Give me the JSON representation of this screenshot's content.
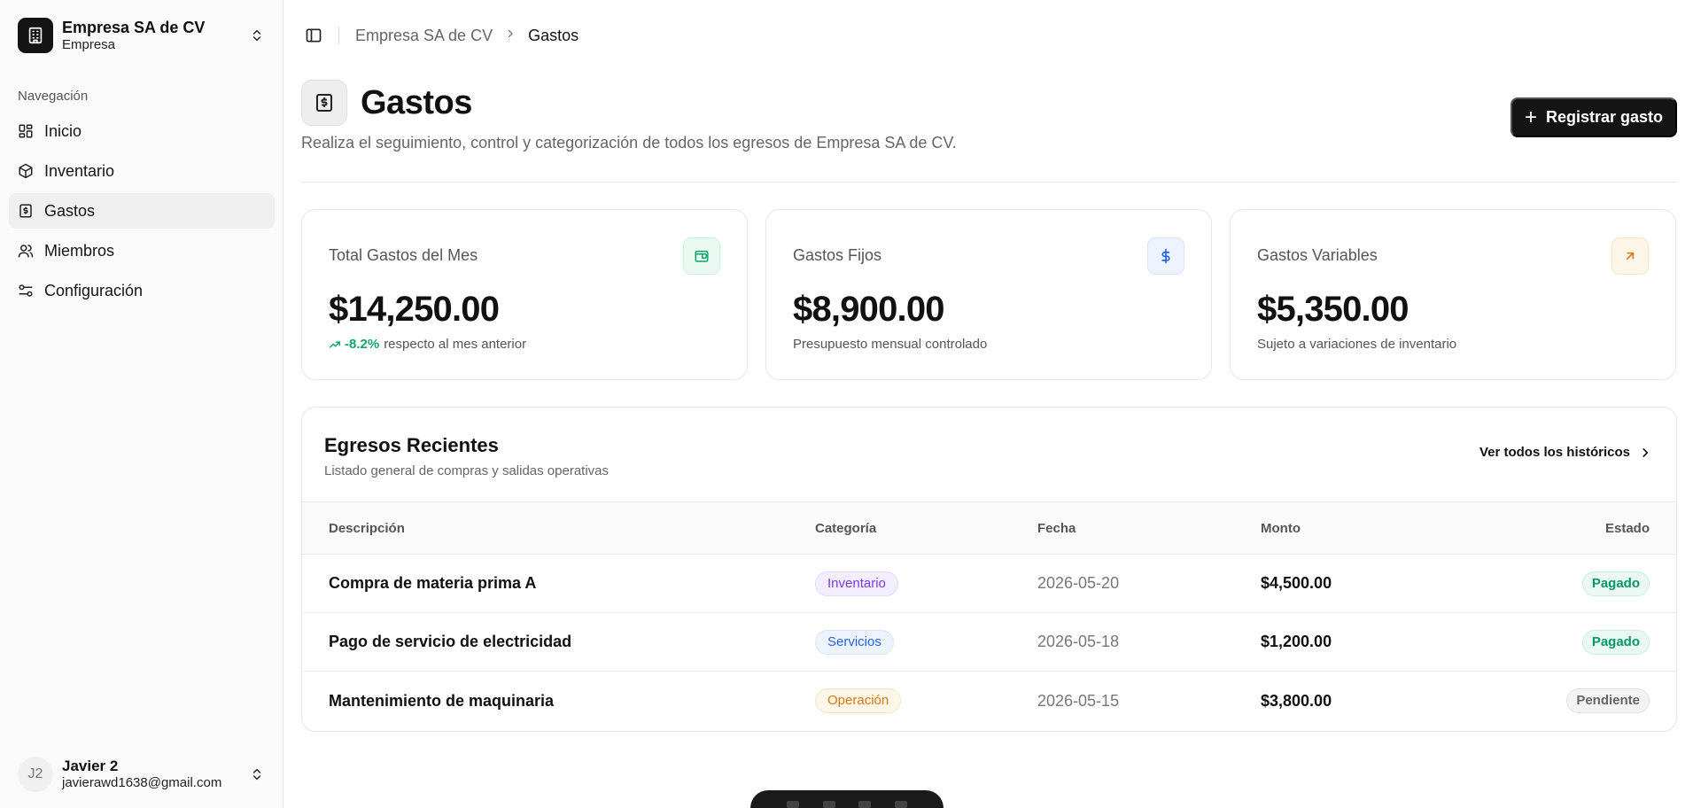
{
  "org": {
    "name": "Empresa SA de CV",
    "type": "Empresa"
  },
  "nav": {
    "heading": "Navegación",
    "items": [
      {
        "label": "Inicio",
        "icon": "dashboard-icon"
      },
      {
        "label": "Inventario",
        "icon": "package-icon"
      },
      {
        "label": "Gastos",
        "icon": "receipt-icon",
        "active": true
      },
      {
        "label": "Miembros",
        "icon": "users-icon"
      },
      {
        "label": "Configuración",
        "icon": "settings-icon"
      }
    ]
  },
  "user": {
    "initials": "J2",
    "name": "Javier 2",
    "email": "javierawd1638@gmail.com"
  },
  "breadcrumb": {
    "parent": "Empresa SA de CV",
    "current": "Gastos"
  },
  "page": {
    "title": "Gastos",
    "description": "Realiza el seguimiento, control y categorización de todos los egresos de Empresa SA de CV.",
    "primary_button": "Registrar gasto"
  },
  "stats": [
    {
      "label": "Total Gastos del Mes",
      "value": "$14,250.00",
      "trend": "-8.2%",
      "sub": "respecto al mes anterior",
      "icon": "wallet-icon",
      "accent": "#10a56b"
    },
    {
      "label": "Gastos Fijos",
      "value": "$8,900.00",
      "sub": "Presupuesto mensual controlado",
      "icon": "dollar-icon",
      "accent": "#2563eb"
    },
    {
      "label": "Gastos Variables",
      "value": "$5,350.00",
      "sub": "Sujeto a variaciones de inventario",
      "icon": "arrow-up-right-icon",
      "accent": "#d97706"
    }
  ],
  "recent": {
    "title": "Egresos Recientes",
    "subtitle": "Listado general de compras y salidas operativas",
    "link": "Ver todos los históricos",
    "columns": [
      "Descripción",
      "Categoría",
      "Fecha",
      "Monto",
      "Estado"
    ],
    "rows": [
      {
        "desc": "Compra de materia prima A",
        "category": "Inventario",
        "date": "2026-05-20",
        "amount": "$4,500.00",
        "status": "Pagado"
      },
      {
        "desc": "Pago de servicio de electricidad",
        "category": "Servicios",
        "date": "2026-05-18",
        "amount": "$1,200.00",
        "status": "Pagado"
      },
      {
        "desc": "Mantenimiento de maquinaria",
        "category": "Operación",
        "date": "2026-05-15",
        "amount": "$3,800.00",
        "status": "Pendiente"
      }
    ]
  }
}
